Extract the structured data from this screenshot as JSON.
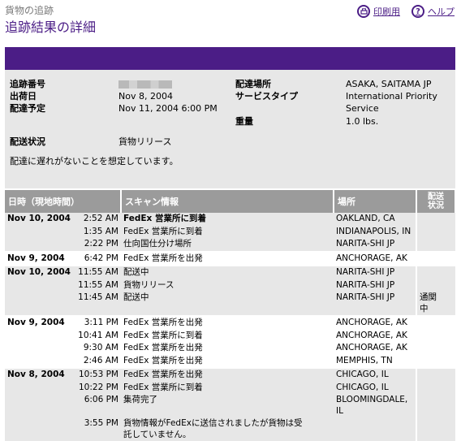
{
  "header": {
    "small_title": "貨物の追跡",
    "title": "追跡結果の詳細",
    "print_label": "印刷用",
    "help_label": "ヘルプ"
  },
  "summary": {
    "tracking_label": "追跡番号",
    "ship_date_label": "出荷日",
    "ship_date": "Nov 8, 2004",
    "delivery_label": "配達予定",
    "delivery": "Nov 11, 2004 6:00 PM",
    "dest_label": "配達場所",
    "dest": "ASAKA, SAITAMA JP",
    "service_label": "サービスタイプ",
    "service_line1": "International Priority",
    "service_line2": "Service",
    "weight_label": "重量",
    "weight": "1.0 lbs.",
    "status_label": "配送状況",
    "status": "貨物リリース",
    "note": "配達に遅れがないことを想定しています。"
  },
  "table": {
    "headers": {
      "datetime": "日時（現地時間）",
      "scan": "スキャン情報",
      "location": "場所",
      "status_line1": "配送",
      "status_line2": "状況"
    },
    "rows": [
      {
        "date": "Nov 10, 2004",
        "time": "2:52 AM",
        "scan": "FedEx 営業所に到着",
        "loc": "OAKLAND, CA",
        "st": "",
        "bold": true,
        "bg": "g",
        "sep": false
      },
      {
        "date": "",
        "time": "1:35 AM",
        "scan": "FedEx 営業所に到着",
        "loc": "INDIANAPOLIS, IN",
        "st": "",
        "bold": false,
        "bg": "g",
        "sep": false
      },
      {
        "date": "",
        "time": "2:22 PM",
        "scan": "仕向国仕分け場所",
        "loc": "NARITA-SHI JP",
        "st": "",
        "bold": false,
        "bg": "g",
        "sep": false
      },
      {
        "date": "Nov 9, 2004",
        "time": "6:42 PM",
        "scan": "FedEx 営業所を出発",
        "loc": "ANCHORAGE, AK",
        "st": "",
        "bold": false,
        "bg": "w",
        "sep": true
      },
      {
        "date": "Nov 10, 2004",
        "time": "11:55 AM",
        "scan": "配送中",
        "loc": "NARITA-SHI JP",
        "st": "",
        "bold": false,
        "bg": "g",
        "sep": true
      },
      {
        "date": "",
        "time": "11:55 AM",
        "scan": "貨物リリース",
        "loc": "NARITA-SHI JP",
        "st": "",
        "bold": false,
        "bg": "g",
        "sep": false
      },
      {
        "date": "",
        "time": "11:45 AM",
        "scan": "配送中",
        "loc": "NARITA-SHI JP",
        "st": "通関\n中",
        "bold": false,
        "bg": "g",
        "sep": false
      },
      {
        "date": "Nov 9, 2004",
        "time": "3:11 PM",
        "scan": "FedEx 営業所を出発",
        "loc": "ANCHORAGE, AK",
        "st": "",
        "bold": false,
        "bg": "w",
        "sep": true
      },
      {
        "date": "",
        "time": "10:41 AM",
        "scan": "FedEx 営業所に到着",
        "loc": "ANCHORAGE, AK",
        "st": "",
        "bold": false,
        "bg": "w",
        "sep": false
      },
      {
        "date": "",
        "time": "9:30 AM",
        "scan": "FedEx 営業所を出発",
        "loc": "ANCHORAGE, AK",
        "st": "",
        "bold": false,
        "bg": "w",
        "sep": false
      },
      {
        "date": "",
        "time": "2:46 AM",
        "scan": "FedEx 営業所を出発",
        "loc": "MEMPHIS, TN",
        "st": "",
        "bold": false,
        "bg": "w",
        "sep": false
      },
      {
        "date": "Nov 8, 2004",
        "time": "10:53 PM",
        "scan": "FedEx 営業所を出発",
        "loc": "CHICAGO, IL",
        "st": "",
        "bold": false,
        "bg": "g",
        "sep": true
      },
      {
        "date": "",
        "time": "10:22 PM",
        "scan": "FedEx 営業所に到着",
        "loc": "CHICAGO, IL",
        "st": "",
        "bold": false,
        "bg": "g",
        "sep": false
      },
      {
        "date": "",
        "time": "6:06 PM",
        "scan": "集荷完了",
        "loc": "BLOOMINGDALE,\nIL",
        "st": "",
        "bold": false,
        "bg": "g",
        "sep": false
      },
      {
        "date": "",
        "time": "3:55 PM",
        "scan": "貨物情報がFedExに送信されましたが貨物は受\n託していません。",
        "loc": "",
        "st": "",
        "bold": false,
        "bg": "g",
        "sep": false
      }
    ]
  }
}
